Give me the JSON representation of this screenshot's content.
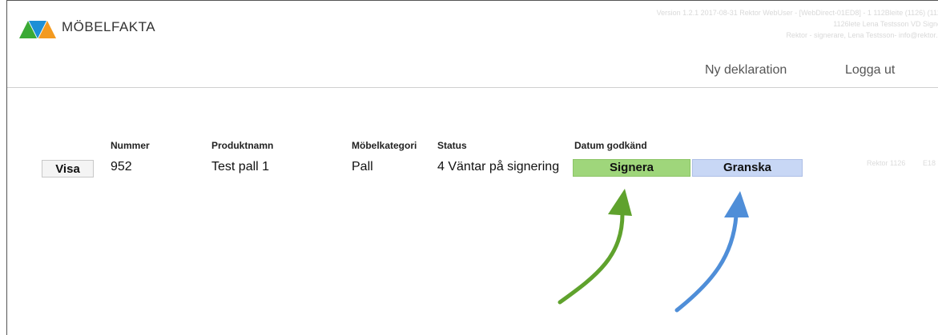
{
  "header": {
    "brand": "MÖBELFAKTA",
    "meta_line1": "Version 1.2.1 2017-08-31 Rektor WebUser - [WebDirect-01ED8] - 1 112Bleite (1126) (112",
    "meta_line2": "1126lete Lena Testsson VD Signe",
    "meta_line3": "Rektor - signerare, Lena Testsson- info@rektor.s",
    "nav_new": "Ny deklaration",
    "nav_logout": "Logga ut"
  },
  "table": {
    "headers": [
      "Nummer",
      "Produktnamn",
      "Möbelkategori",
      "Status",
      "Datum godkänd"
    ],
    "row": {
      "view_label": "Visa",
      "number": "952",
      "product": "Test pall 1",
      "category": "Pall",
      "status": "4 Väntar på signering",
      "sign_label": "Signera",
      "review_label": "Granska",
      "extra1": "Rektor 1126",
      "extra2": "E18"
    }
  },
  "colors": {
    "logo_green": "#3aaa35",
    "logo_blue": "#1d8fd6",
    "logo_orange": "#f39a1f",
    "sign_bg": "#9fd67b",
    "review_bg": "#c8d7f5",
    "arrow_green": "#5fa22d",
    "arrow_blue": "#4f8ed8"
  }
}
